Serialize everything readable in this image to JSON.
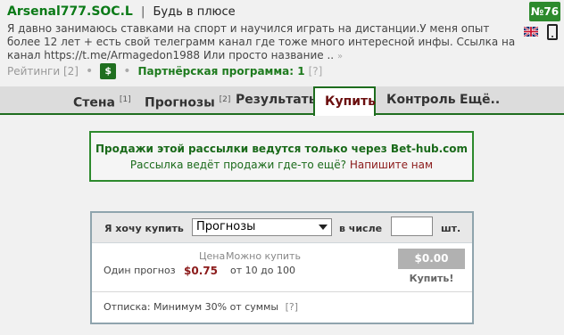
{
  "header": {
    "site_name": "Arsenal777.SOC.L",
    "separator": "|",
    "tagline": "Будь в плюсе",
    "rank": "№76",
    "description": "Я давно занимаюсь ставками на спорт и научился играть на дистанции.У меня опыт более 12 лет + есть свой телеграмм канал где тоже много интересной инфы. Ссылка на канал https://t.me/Armagedon1988 Или просто название .. ",
    "more_arrow": "»",
    "ratings_label": "Рейтинги",
    "ratings_count": "[2]",
    "dot1": "•",
    "dot2": "•",
    "dollar_label": "$",
    "partner_label": "Партнёрская программа: 1",
    "partner_help": "[?]"
  },
  "tabs": [
    {
      "label": "Стена",
      "count": "[1]"
    },
    {
      "label": "Прогнозы",
      "count": "[2]"
    },
    {
      "label": "Результаты",
      "count": ""
    },
    {
      "label": "Купить",
      "count": ""
    },
    {
      "label": "Контроль",
      "count": ""
    },
    {
      "label": "Ещё..",
      "count": ""
    }
  ],
  "notice": {
    "title": "Продажи этой рассылки ведутся только через Bet-hub.com",
    "sub_text": "Рассылка ведёт продажи где-то ещё?",
    "sub_link": "Напишите нам"
  },
  "buy": {
    "want_label": "Я хочу купить",
    "selected": "Прогнозы",
    "count_label": "в числе",
    "count_value": "",
    "units_label": "шт.",
    "price_header": "Цена",
    "avail_header": "Можно купить",
    "item_label": "Один прогноз",
    "price": "$0.75",
    "range": "от 10 до 100",
    "total": "$0.00",
    "buy_label": "Купить!",
    "commission_label": "Отписка:",
    "commission_text": "Минимум 30% от суммы",
    "commission_help": "[?]"
  },
  "colors": {
    "brand_green": "#0b7a17",
    "accent_dark_red": "#8b1a1a",
    "badge_green": "#2d8a2d"
  }
}
